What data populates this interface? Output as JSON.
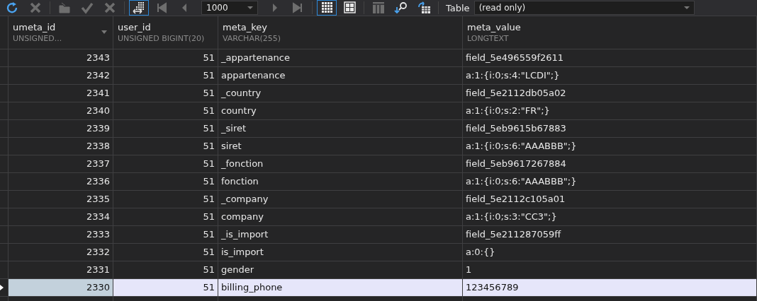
{
  "toolbar": {
    "left": [
      {
        "kind": "refresh",
        "disabled": false,
        "selected": false
      },
      {
        "kind": "cancel",
        "disabled": true,
        "selected": false
      },
      {
        "kind": "sep"
      },
      {
        "kind": "save",
        "disabled": true,
        "selected": false
      },
      {
        "kind": "apply",
        "disabled": true,
        "selected": false
      },
      {
        "kind": "cancel",
        "disabled": true,
        "selected": false
      },
      {
        "kind": "sep"
      },
      {
        "kind": "autosize",
        "disabled": false,
        "selected": true
      },
      {
        "kind": "first",
        "disabled": true,
        "selected": false
      },
      {
        "kind": "prev",
        "disabled": true,
        "selected": false
      }
    ],
    "limit": {
      "value": "1000"
    },
    "right": [
      {
        "kind": "next",
        "disabled": true,
        "selected": false
      },
      {
        "kind": "last",
        "disabled": true,
        "selected": false
      },
      {
        "kind": "sep"
      },
      {
        "kind": "grid",
        "disabled": false,
        "selected": true
      },
      {
        "kind": "form",
        "disabled": false,
        "selected": false
      },
      {
        "kind": "sep"
      },
      {
        "kind": "columns",
        "disabled": true,
        "selected": false
      },
      {
        "kind": "find",
        "disabled": false,
        "selected": false
      },
      {
        "kind": "export",
        "disabled": false,
        "selected": false
      },
      {
        "kind": "sep"
      }
    ],
    "table_label": "Table",
    "table_value": "(read only)"
  },
  "table": {
    "columns": [
      {
        "name": "umeta_id",
        "type": "UNSIGNED...",
        "sorted": true
      },
      {
        "name": "user_id",
        "type": "UNSIGNED BIGINT(20)",
        "sorted": false
      },
      {
        "name": "meta_key",
        "type": "VARCHAR(255)",
        "sorted": false
      },
      {
        "name": "meta_value",
        "type": "LONGTEXT",
        "sorted": false
      }
    ],
    "rows": [
      {
        "cells": [
          "2343",
          "51",
          "_appartenance",
          "field_5e496559f2611"
        ],
        "selected": false
      },
      {
        "cells": [
          "2342",
          "51",
          "appartenance",
          "a:1:{i:0;s:4:\"LCDI\";}"
        ],
        "selected": false
      },
      {
        "cells": [
          "2341",
          "51",
          "_country",
          "field_5e2112db05a02"
        ],
        "selected": false
      },
      {
        "cells": [
          "2340",
          "51",
          "country",
          "a:1:{i:0;s:2:\"FR\";}"
        ],
        "selected": false
      },
      {
        "cells": [
          "2339",
          "51",
          "_siret",
          "field_5eb9615b67883"
        ],
        "selected": false
      },
      {
        "cells": [
          "2338",
          "51",
          "siret",
          "a:1:{i:0;s:6:\"AAABBB\";}"
        ],
        "selected": false
      },
      {
        "cells": [
          "2337",
          "51",
          "_fonction",
          "field_5eb9617267884"
        ],
        "selected": false
      },
      {
        "cells": [
          "2336",
          "51",
          "fonction",
          "a:1:{i:0;s:6:\"AAABBB\";}"
        ],
        "selected": false
      },
      {
        "cells": [
          "2335",
          "51",
          "_company",
          "field_5e2112c105a01"
        ],
        "selected": false
      },
      {
        "cells": [
          "2334",
          "51",
          "company",
          "a:1:{i:0;s:3:\"CC3\";}"
        ],
        "selected": false
      },
      {
        "cells": [
          "2333",
          "51",
          "_is_import",
          "field_5e211287059ff"
        ],
        "selected": false
      },
      {
        "cells": [
          "2332",
          "51",
          "is_import",
          "a:0:{}"
        ],
        "selected": false
      },
      {
        "cells": [
          "2331",
          "51",
          "gender",
          "1"
        ],
        "selected": false
      },
      {
        "cells": [
          "2330",
          "51",
          "billing_phone",
          "123456789"
        ],
        "selected": true
      }
    ]
  }
}
